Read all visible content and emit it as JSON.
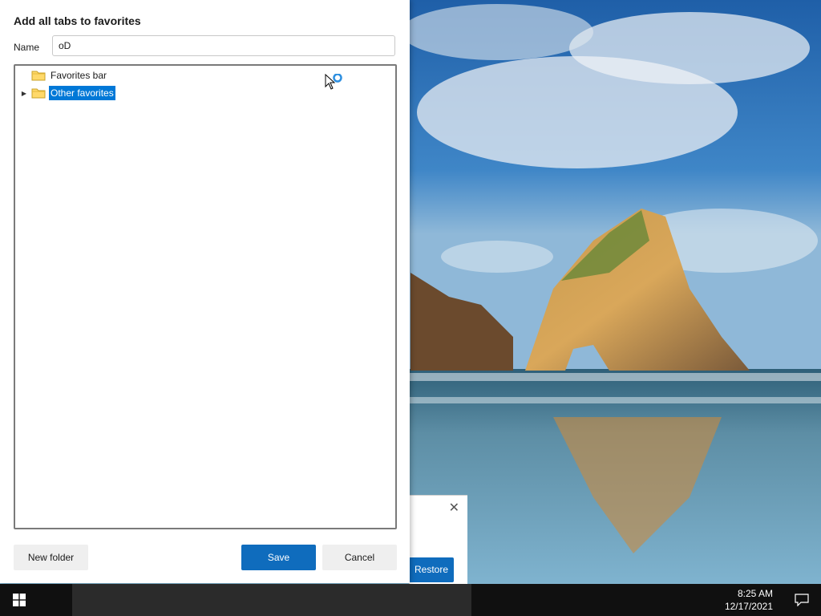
{
  "dialog": {
    "title": "Add all tabs to favorites",
    "name_label": "Name",
    "name_value": "oD",
    "tree": [
      {
        "label": "Favorites bar",
        "icon": "folder-icon",
        "expandable": false,
        "selected": false
      },
      {
        "label": "Other favorites",
        "icon": "folder-icon",
        "expandable": true,
        "selected": true
      }
    ],
    "buttons": {
      "new_folder": "New folder",
      "save": "Save",
      "cancel": "Cancel"
    }
  },
  "background_window": {
    "restore_label": "Restore",
    "close_icon": "close-icon"
  },
  "taskbar": {
    "time": "8:25 AM",
    "date": "12/17/2021",
    "start_icon": "windows-logo-icon",
    "notifications_icon": "notifications-icon"
  },
  "colors": {
    "accent": "#0f6cbd",
    "selection": "#0078d7",
    "taskbar": "#101010"
  }
}
